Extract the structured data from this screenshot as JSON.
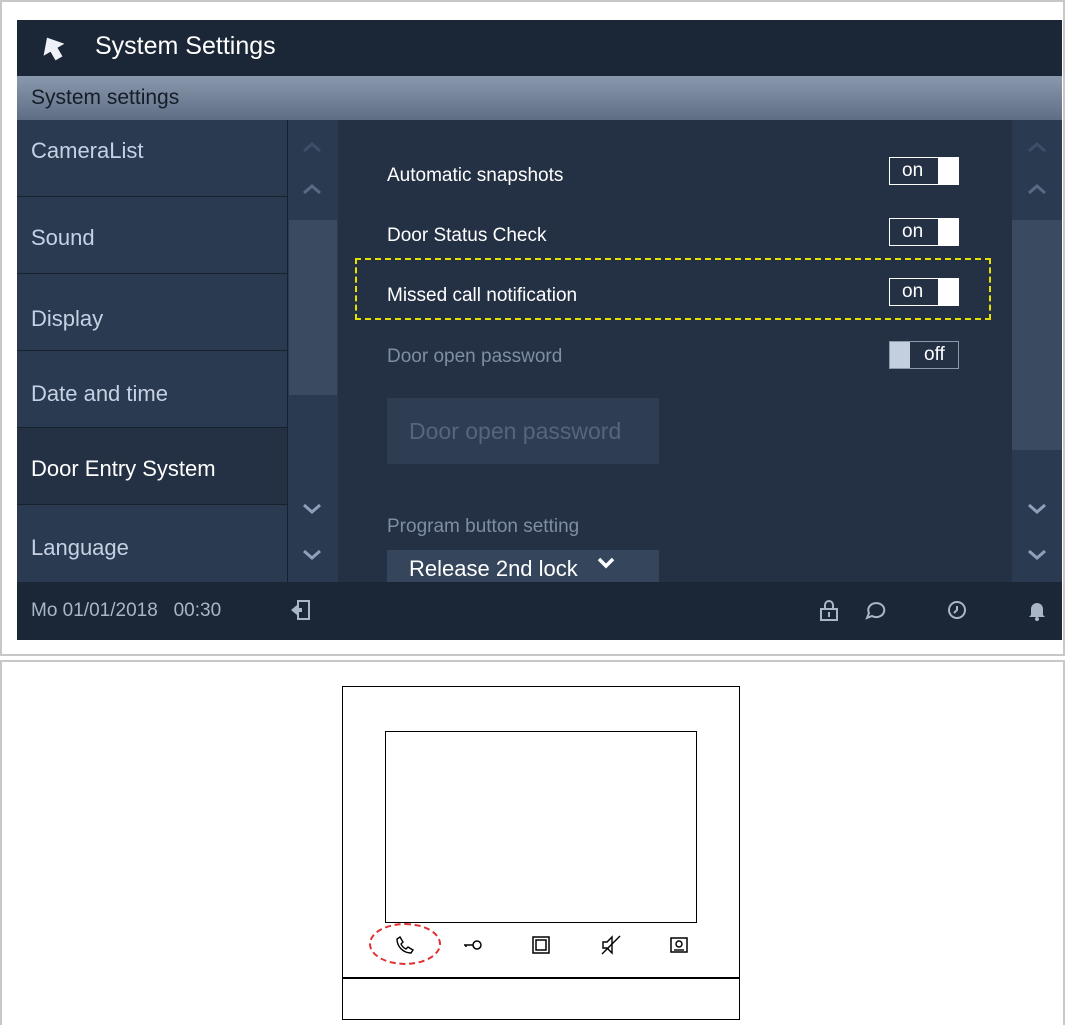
{
  "header": {
    "title": "System Settings"
  },
  "subheader": {
    "title": "System settings"
  },
  "sidebar": {
    "items": [
      {
        "label": "CameraList",
        "active": false
      },
      {
        "label": "Sound",
        "active": false
      },
      {
        "label": "Display",
        "active": false
      },
      {
        "label": "Date and time",
        "active": false
      },
      {
        "label": "Door Entry System",
        "active": true
      },
      {
        "label": "Language",
        "active": false
      }
    ]
  },
  "settings": {
    "automatic_snapshots": {
      "label": "Automatic snapshots",
      "state": "on"
    },
    "door_status_check": {
      "label": "Door Status Check",
      "state": "on"
    },
    "missed_call_notification": {
      "label": "Missed call notification",
      "state": "on"
    },
    "door_open_password": {
      "label": "Door open password",
      "state": "off"
    },
    "door_open_password_button": {
      "label": "Door open password"
    },
    "program_button_setting": {
      "label": "Program button setting"
    },
    "program_button_value": {
      "label": "Release 2nd lock"
    }
  },
  "footer": {
    "datetime": "Mo 01/01/2018   00:30"
  },
  "icons": {
    "back": "back-arrow-icon",
    "logout": "logout-icon",
    "lock": "lock-icon",
    "message": "message-icon",
    "history": "history-icon",
    "bell": "bell-icon",
    "device_buttons": [
      "phone-icon",
      "key-icon",
      "square-icon",
      "mute-icon",
      "camera-icon"
    ]
  },
  "colors": {
    "screen_bg": "#243044",
    "highlight": "#e8e000",
    "callout": "#e03030"
  }
}
